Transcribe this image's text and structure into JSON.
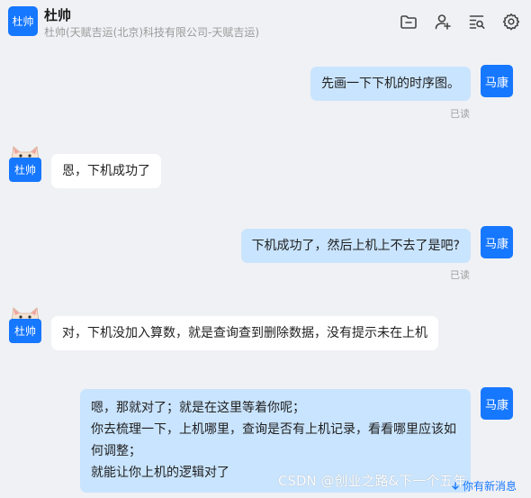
{
  "header": {
    "avatar_text": "杜帅",
    "title": "杜帅",
    "subtitle": "杜帅(天赋吉运(北京)科技有限公司-天赋吉运)",
    "tools": [
      "folder-icon",
      "add-user-icon",
      "search-list-icon",
      "settings-icon"
    ]
  },
  "messages": [
    {
      "side": "right",
      "sender": "马康",
      "text": "先画一下下机的时序图。",
      "status": "已读"
    },
    {
      "side": "left",
      "sender": "杜帅",
      "text": "恩，下机成功了"
    },
    {
      "side": "right",
      "sender": "马康",
      "text": "下机成功了，然后上机上不去了是吧?",
      "status": "已读"
    },
    {
      "side": "left",
      "sender": "杜帅",
      "text": "对，下机没加入算数，就是查询查到删除数据，没有提示未在上机"
    },
    {
      "side": "right",
      "sender": "马康",
      "lines": [
        "嗯，那就对了；就是在这里等着你呢；",
        "你去梳理一下，上机哪里，查询是否有上机记录，看看哪里应该如",
        "何调整；",
        "就能让你上机的逻辑对了"
      ]
    }
  ],
  "watermark": "CSDN @创业之路&下一个五年",
  "new_message_hint": "你有新消息"
}
